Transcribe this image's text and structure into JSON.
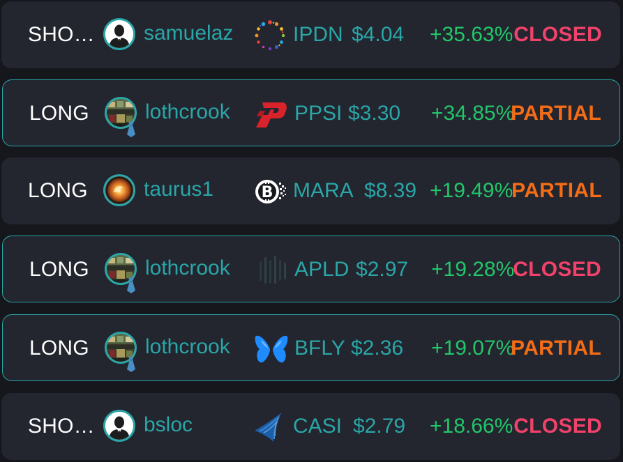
{
  "trades": [
    {
      "side": "SHO…",
      "user": "samuelaz",
      "avatar": "person-silhouette-icon",
      "ticker": "IPDN",
      "price": "$4.04",
      "change": "+35.63%",
      "status": "CLOSED",
      "logo": "dotted-ring-logo-icon"
    },
    {
      "side": "LONG",
      "user": "lothcrook",
      "avatar": "photo-avatar-with-tie-icon",
      "ticker": "PPSI",
      "price": "$3.30",
      "change": "+34.85%",
      "status": "PARTIAL",
      "logo": "red-p-logo-icon"
    },
    {
      "side": "LONG",
      "user": "taurus1",
      "avatar": "fire-avatar-icon",
      "ticker": "MARA",
      "price": "$8.39",
      "change": "+19.49%",
      "status": "PARTIAL",
      "logo": "bitcoin-logo-icon"
    },
    {
      "side": "LONG",
      "user": "lothcrook",
      "avatar": "photo-avatar-with-tie-icon",
      "ticker": "APLD",
      "price": "$2.97",
      "change": "+19.28%",
      "status": "CLOSED",
      "logo": "vertical-bars-logo-icon"
    },
    {
      "side": "LONG",
      "user": "lothcrook",
      "avatar": "photo-avatar-with-tie-icon",
      "ticker": "BFLY",
      "price": "$2.36",
      "change": "+19.07%",
      "status": "PARTIAL",
      "logo": "butterfly-logo-icon"
    },
    {
      "side": "SHO…",
      "user": "bsloc",
      "avatar": "person-silhouette-icon",
      "ticker": "CASI",
      "price": "$2.79",
      "change": "+18.66%",
      "status": "CLOSED",
      "logo": "blue-wave-logo-icon"
    }
  ],
  "colors": {
    "background": "#16171d",
    "card": "#23252f",
    "accent_teal": "#2aa6a7",
    "positive_green": "#22c76a",
    "closed_red": "#f0426a",
    "partial_orange": "#f46d16"
  }
}
